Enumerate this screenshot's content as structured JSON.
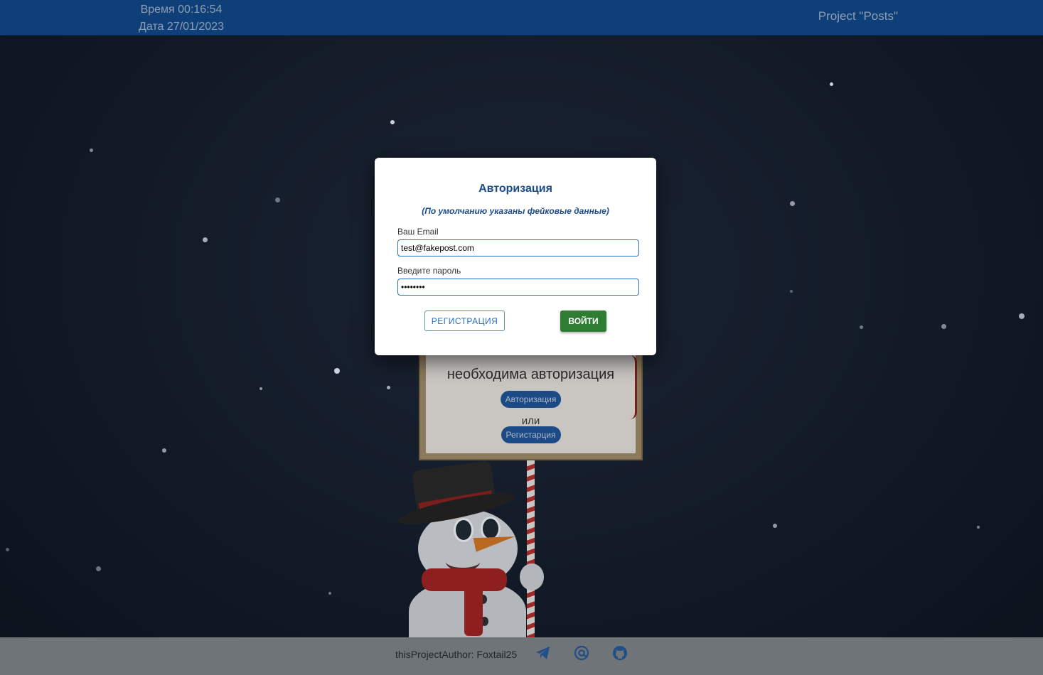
{
  "header": {
    "time_text": "Время 00:16:54",
    "date_text": "Дата 27/01/2023",
    "project_title": "Project \"Posts\""
  },
  "background_board": {
    "message": "необходима авторизация",
    "auth_button": "Авторизация",
    "or_text": "или",
    "register_button": "Регистарция"
  },
  "modal": {
    "title": "Авторизация",
    "subtitle": "(По умолчанию указаны фейковые данные)",
    "email_label": "Ваш Email",
    "email_value": "test@fakepost.com",
    "password_label": "Введите пароль",
    "password_value": "fakepass",
    "register_button": "РЕГИСТРАЦИЯ",
    "login_button": "ВОЙТИ"
  },
  "footer": {
    "author_text": "thisProjectAuthor: Foxtail25",
    "icons": [
      "telegram-icon",
      "email-at-icon",
      "github-icon"
    ]
  },
  "colors": {
    "header_bg": "#0f3f78",
    "accent_blue": "#1b4b8a",
    "login_green": "#2e7d32",
    "footer_bg": "#6f7479"
  }
}
